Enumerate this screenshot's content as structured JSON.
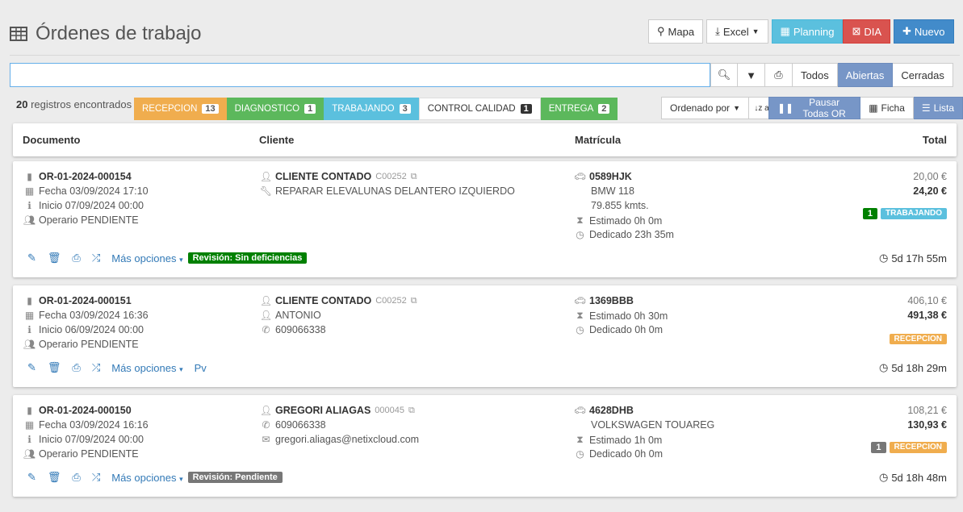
{
  "header": {
    "title": "Órdenes de trabajo",
    "buttons": {
      "mapa": "Mapa",
      "excel": "Excel",
      "planning": "Planning",
      "dia": "DIA",
      "nuevo": "Nuevo"
    }
  },
  "search": {
    "value": "",
    "filters": [
      "Todos",
      "Abiertas",
      "Cerradas"
    ],
    "active_filter": "Abiertas"
  },
  "summary": {
    "count": "20",
    "label": "registros encontrados",
    "stats": [
      {
        "label": "RECEPCION",
        "count": "13"
      },
      {
        "label": "DIAGNOSTICO",
        "count": "1"
      },
      {
        "label": "TRABAJANDO",
        "count": "3"
      },
      {
        "label": "CONTROL CALIDAD",
        "count": "1"
      },
      {
        "label": "ENTREGA",
        "count": "2"
      }
    ]
  },
  "toolbar2": {
    "ordenado": "Ordenado por",
    "sort_icon_text": "↓z a",
    "pausar": "Pausar Todas OR",
    "ficha": "Ficha",
    "lista": "Lista"
  },
  "table": {
    "columns": [
      "Documento",
      "Cliente",
      "Matrícula",
      "Total"
    ]
  },
  "orders": [
    {
      "doc": "OR-01-2024-000154",
      "fecha": "Fecha 03/09/2024 17:10",
      "inicio": "Inicio 07/09/2024 00:00",
      "operario": "Operario PENDIENTE",
      "cliente": "CLIENTE CONTADO",
      "cliente_code": "C00252",
      "cliente_line2": "REPARAR ELEVALUNAS DELANTERO IZQUIERDO",
      "cliente_line3": "",
      "matricula": "0589HJK",
      "modelo": "BMW 118",
      "kms": "79.855 kmts.",
      "estimado": "Estimado 0h 0m",
      "dedicado": "Dedicado 23h 35m",
      "subtotal": "20,00 €",
      "total": "24,20 €",
      "count_badge": "1",
      "status": "TRABAJANDO",
      "mas": "Más opciones",
      "revision": "Revisión: Sin deficiencias",
      "extra": "",
      "elapsed": "5d 17h 55m"
    },
    {
      "doc": "OR-01-2024-000151",
      "fecha": "Fecha 03/09/2024 16:36",
      "inicio": "Inicio 06/09/2024 00:00",
      "operario": "Operario PENDIENTE",
      "cliente": "CLIENTE CONTADO",
      "cliente_code": "C00252",
      "cliente_line2": "ANTONIO",
      "cliente_line3": "609066338",
      "matricula": "1369BBB",
      "modelo": "",
      "kms": "",
      "estimado": "Estimado 0h 30m",
      "dedicado": "Dedicado 0h 0m",
      "subtotal": "406,10 €",
      "total": "491,38 €",
      "count_badge": "",
      "status": "RECEPCION",
      "mas": "Más opciones",
      "revision": "",
      "extra": "Pv",
      "elapsed": "5d 18h 29m"
    },
    {
      "doc": "OR-01-2024-000150",
      "fecha": "Fecha 03/09/2024 16:16",
      "inicio": "Inicio 07/09/2024 00:00",
      "operario": "Operario PENDIENTE",
      "cliente": "GREGORI ALIAGAS",
      "cliente_code": "000045",
      "cliente_line2": "609066338",
      "cliente_line3": "gregori.aliagas@netixcloud.com",
      "matricula": "4628DHB",
      "modelo": "VOLKSWAGEN TOUAREG",
      "kms": "",
      "estimado": "Estimado 1h 0m",
      "dedicado": "Dedicado 0h 0m",
      "subtotal": "108,21 €",
      "total": "130,93 €",
      "count_badge": "1",
      "status": "RECEPCION",
      "mas": "Más opciones",
      "revision": "Revisión: Pendiente",
      "extra": "",
      "elapsed": "5d 18h 48m"
    }
  ]
}
